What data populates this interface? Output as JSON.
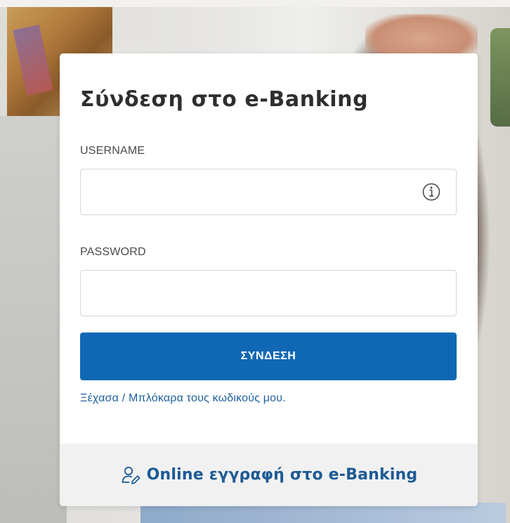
{
  "login_card": {
    "title": "Σύνδεση στο e-Banking",
    "username": {
      "label": "USERNAME",
      "value": "",
      "placeholder": "",
      "info_icon": "info-circle-icon"
    },
    "password": {
      "label": "PASSWORD",
      "value": "",
      "placeholder": ""
    },
    "submit_label": "ΣΥΝΔΕΣΗ",
    "forgot_link": "Ξέχασα / Μπλόκαρα τους κωδικούς μου.",
    "register": {
      "icon": "user-edit-icon",
      "label": "Online εγγραφή στο e-Banking"
    }
  },
  "colors": {
    "primary_button": "#1068b4",
    "link": "#1d5f9e",
    "footer_background": "#f1f1f1",
    "title_text": "#2e2e2e"
  }
}
